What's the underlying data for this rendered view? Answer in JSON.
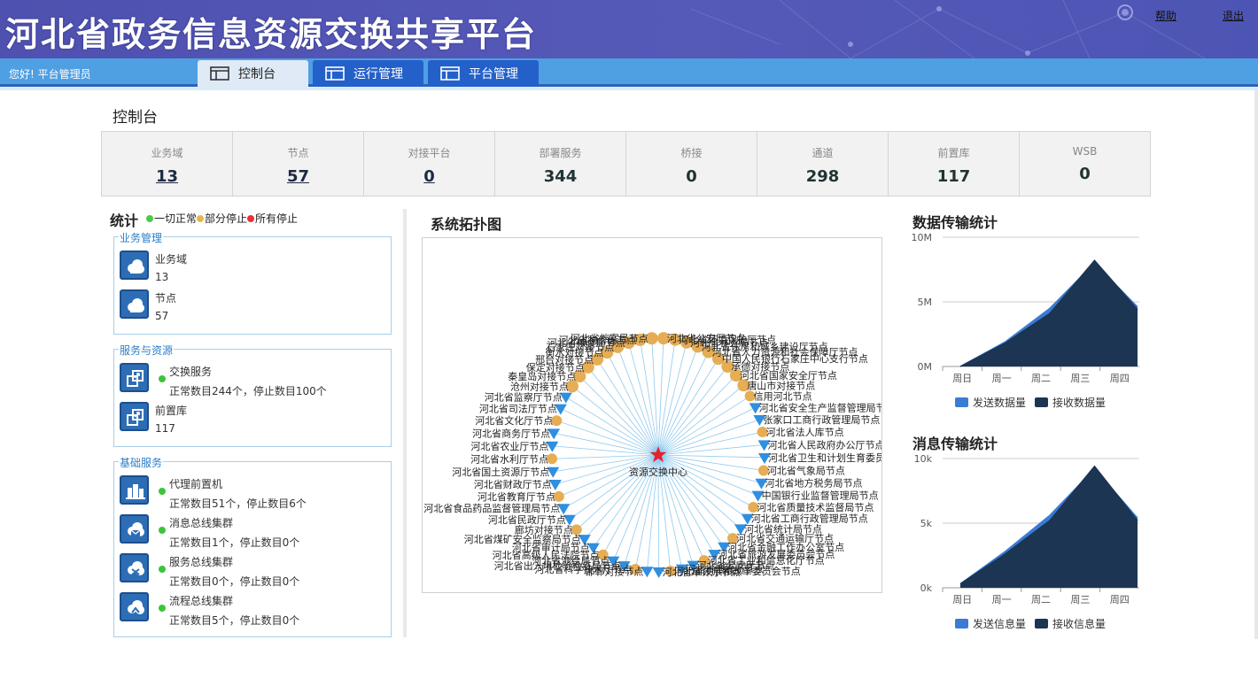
{
  "header": {
    "title": "河北省政务信息资源交换共享平台",
    "help_link": "帮助",
    "logout_link": "退出"
  },
  "navbar": {
    "greeting": "您好!   平台管理员",
    "tabs": [
      {
        "label": "控制台",
        "active": true
      },
      {
        "label": "运行管理",
        "active": false
      },
      {
        "label": "平台管理",
        "active": false
      }
    ]
  },
  "page": {
    "title": "控制台"
  },
  "stats": [
    {
      "label": "业务域",
      "value": "13"
    },
    {
      "label": "节点",
      "value": "57"
    },
    {
      "label": "对接平台",
      "value": "0"
    },
    {
      "label": "部署服务",
      "value": "344"
    },
    {
      "label": "桥接",
      "value": "0"
    },
    {
      "label": "通道",
      "value": "298"
    },
    {
      "label": "前置库",
      "value": "117"
    },
    {
      "label": "WSB",
      "value": "0"
    }
  ],
  "statistics": {
    "title": "统计",
    "legend": {
      "normal": "一切正常",
      "partial": "部分停止",
      "stopped": "所有停止",
      "colors": {
        "normal": "#4bc94b",
        "partial": "#e6b84a",
        "stopped": "#e8303a"
      }
    },
    "groups": [
      {
        "title": "业务管理",
        "items": [
          {
            "name": "业务域",
            "detail": "13",
            "icon": "cloud-icon",
            "status": false
          },
          {
            "name": "节点",
            "detail": "57",
            "icon": "cloud-icon",
            "status": false
          }
        ]
      },
      {
        "title": "服务与资源",
        "items": [
          {
            "name": "交换服务",
            "detail": "正常数目244个，停止数目100个",
            "icon": "exchange-icon",
            "status": true
          },
          {
            "name": "前置库",
            "detail": "117",
            "icon": "exchange-icon",
            "status": false
          }
        ]
      },
      {
        "title": "基础服务",
        "items": [
          {
            "name": "代理前置机",
            "detail": "正常数目51个，停止数目6个",
            "icon": "building-icon",
            "status": true
          },
          {
            "name": "消息总线集群",
            "detail": "正常数目1个，停止数目0个",
            "icon": "message-cloud-icon",
            "status": true
          },
          {
            "name": "服务总线集群",
            "detail": "正常数目0个，停止数目0个",
            "icon": "service-cloud-icon",
            "status": true
          },
          {
            "name": "流程总线集群",
            "detail": "正常数目5个，停止数目0个",
            "icon": "flow-cloud-icon",
            "status": true
          }
        ]
      }
    ]
  },
  "topology": {
    "title": "系统拓扑图",
    "center_label": "资源交换中心",
    "node_labels": [
      "河北省公安厅节点",
      "河北省环境保护厅节点",
      "河北省林业局节点",
      "河北省住房和城乡建设厅节点",
      "河北省人力资源和社会保障厅节点",
      "中国人民银行石家庄中心支行节点",
      "承德对接节点",
      "河北省国家安全厅节点",
      "唐山市对接节点",
      "信用河北节点",
      "河北省安全生产监督管理局节点",
      "张家口工商行政管理局节点",
      "河北省法人库节点",
      "河北省人民政府办公厅节点",
      "河北省卫生和计划生育委员会节点",
      "河北省气象局节点",
      "河北省地方税务局节点",
      "中国银行业监督管理局节点",
      "河北省质量技术监督局节点",
      "河北省工商行政管理局节点",
      "河北省统计局节点",
      "河北省交通运输厅节点",
      "河北省金融工作办公室节点",
      "河北省旅游发展委员会节点",
      "河北省工业和信息化厅节点",
      "河北省公安厅节点",
      "河北省地震局节点",
      "河北省发展和改革委员会节点",
      "河北省审计厅节点",
      "邯郸对接节点",
      "河北省科学技术厅节点",
      "河北省出入境检验检疫局节点",
      "河北省测绘局节点",
      "河北省高级人民法院节点",
      "河北省审计局节点",
      "河北省煤矿安全监察局节点",
      "廊坊对接节点",
      "河北省民政厅节点",
      "河北省食品药品监督管理局节点",
      "河北省教育厅节点",
      "河北省财政厅节点",
      "河北省国土资源厅节点",
      "河北省水利厅节点",
      "河北省农业厅节点",
      "河北省商务厅节点",
      "河北省文化厅节点",
      "河北省司法厅节点",
      "河北省监察厅节点",
      "沧州对接节点",
      "秦皇岛对接节点",
      "保定对接节点",
      "邢台对接节点",
      "衡水对接节点",
      "石家庄对接节点",
      "河北省粮食局节点",
      "河北省物价局节点",
      "河北省档案局节点"
    ]
  },
  "data_transfer": {
    "title": "数据传输统计",
    "chart_data": {
      "type": "area",
      "categories": [
        "周日",
        "周一",
        "周二",
        "周三",
        "周四"
      ],
      "y_ticks": [
        "0M",
        "5M",
        "10M"
      ],
      "ylim": [
        0,
        10
      ],
      "series": [
        {
          "name": "发送数据量",
          "color": "#3a7bd5",
          "values": [
            0,
            1.9,
            4.5,
            8.0,
            4.6
          ]
        },
        {
          "name": "接收数据量",
          "color": "#1c3552",
          "values": [
            0,
            1.8,
            4.1,
            8.2,
            4.4
          ]
        }
      ]
    }
  },
  "message_transfer": {
    "title": "消息传输统计",
    "chart_data": {
      "type": "area",
      "categories": [
        "周日",
        "周一",
        "周二",
        "周三",
        "周四"
      ],
      "y_ticks": [
        "0k",
        "5k",
        "10k"
      ],
      "ylim": [
        0,
        10
      ],
      "series": [
        {
          "name": "发送信息量",
          "color": "#3a7bd5",
          "values": [
            0.3,
            2.8,
            5.6,
            9.2,
            5.4
          ]
        },
        {
          "name": "接收信息量",
          "color": "#1c3552",
          "values": [
            0.3,
            2.6,
            5.2,
            9.4,
            5.2
          ]
        }
      ]
    }
  }
}
